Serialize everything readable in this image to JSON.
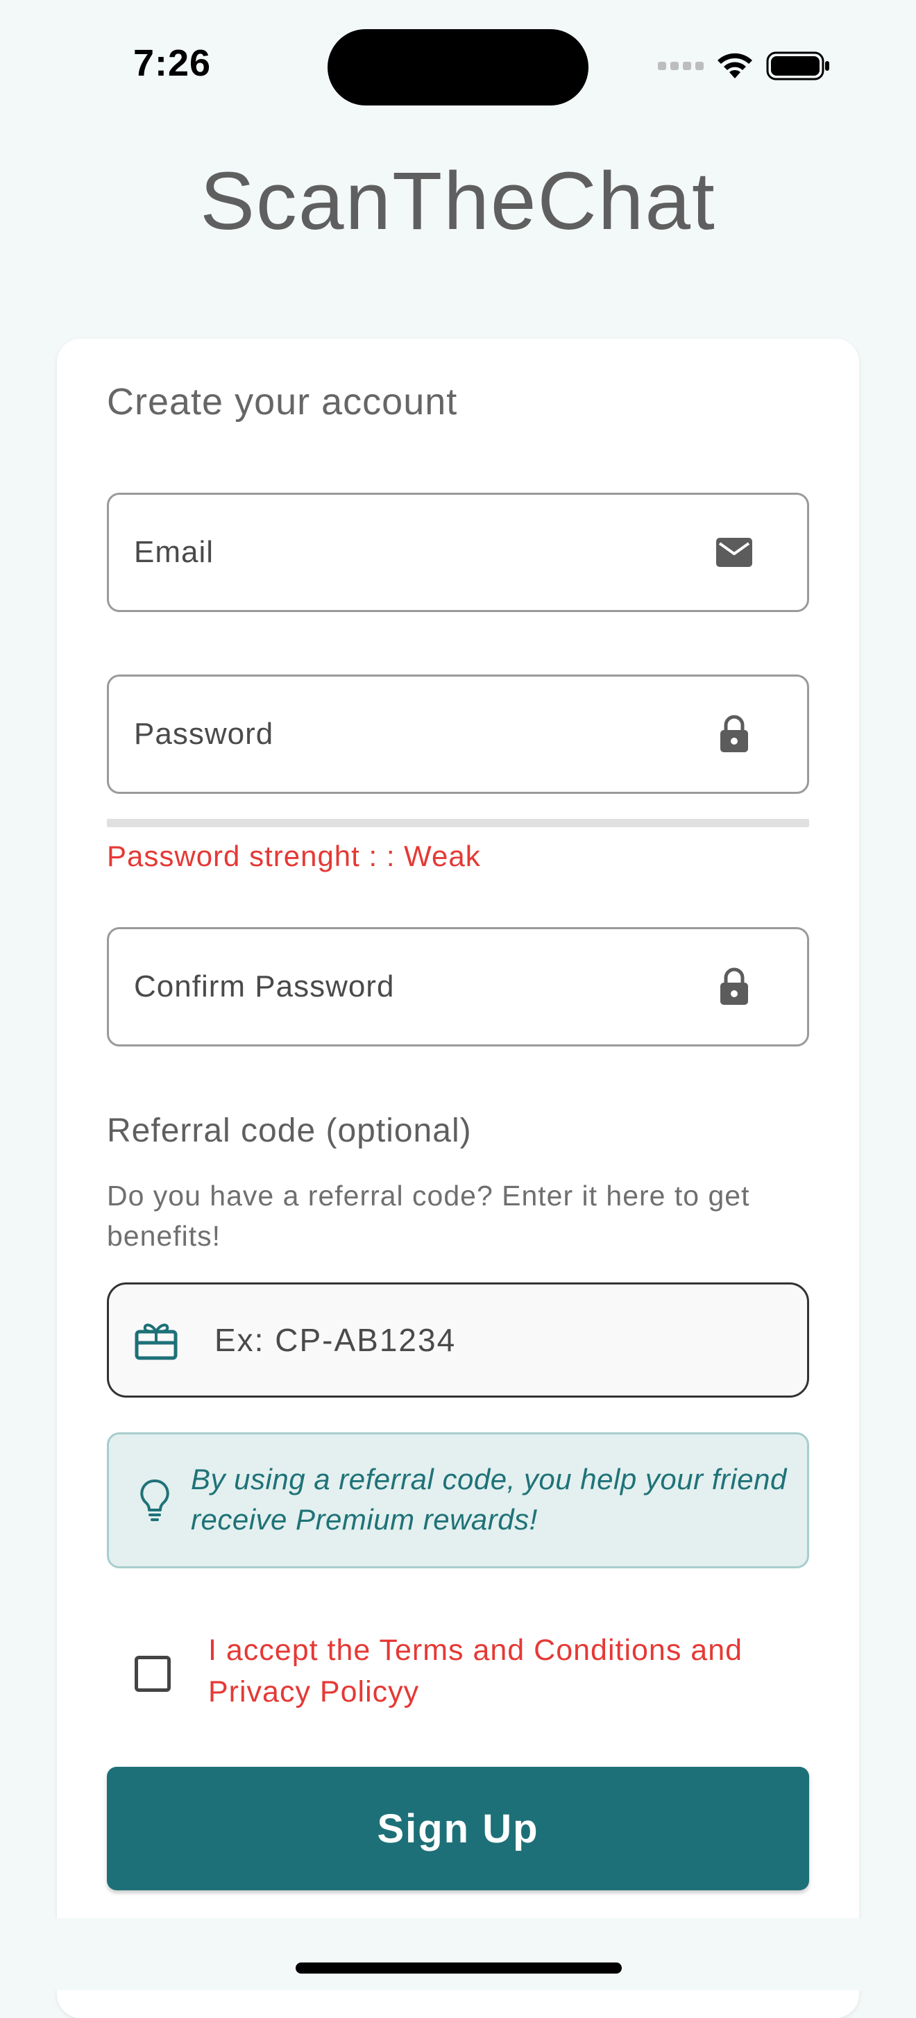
{
  "status_bar": {
    "time": "7:26"
  },
  "app": {
    "title": "ScanTheChat"
  },
  "form": {
    "heading": "Create your account",
    "email": {
      "placeholder": "Email",
      "value": "",
      "icon": "mail-icon"
    },
    "password": {
      "placeholder": "Password",
      "value": "",
      "icon": "lock-icon"
    },
    "password_strength": {
      "label": "Password strenght : : Weak",
      "level": 0
    },
    "confirm_password": {
      "placeholder": "Confirm Password",
      "value": "",
      "icon": "lock-icon"
    },
    "referral": {
      "title": "Referral code (optional)",
      "description": "Do you have a referral code? Enter it here to get benefits!",
      "placeholder": "Ex: CP-AB1234",
      "value": "",
      "icon": "gift-icon"
    },
    "info": {
      "text": "By using a referral code, you help your friend receive Premium rewards!",
      "icon": "lightbulb-icon"
    },
    "terms": {
      "label": "I accept the Terms and Conditions and Privacy Policyy",
      "checked": false
    },
    "submit_label": "Sign Up"
  },
  "colors": {
    "accent": "#1e7078",
    "error": "#e53935",
    "background": "#f3f8f8",
    "info_background": "#e3f0ef",
    "info_text": "#1f7278"
  }
}
